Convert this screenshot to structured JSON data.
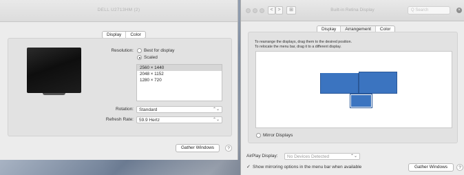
{
  "left_window": {
    "title": "DELL U2713HM (2)",
    "tabs": [
      "Display",
      "Color"
    ],
    "resolution_label": "Resolution:",
    "resolution_options": [
      "Best for display",
      "Scaled"
    ],
    "resolutions": [
      "2560 × 1440",
      "2048 × 1152",
      "1280 × 720"
    ],
    "rotation_label": "Rotation:",
    "rotation_value": "Standard",
    "refresh_label": "Refresh Rate:",
    "refresh_value": "59.9 Hertz",
    "gather_button": "Gather Windows",
    "help": "?"
  },
  "right_window": {
    "title": "Built-in Retina Display",
    "search_placeholder": "Q Search",
    "nav_back": "<",
    "nav_forward": ">",
    "grid_icon": "⊞",
    "tabs": [
      "Display",
      "Arrangement",
      "Color"
    ],
    "instruction_line1": "To rearrange the displays, drag them to the desired position.",
    "instruction_line2": "To relocate the menu bar, drag it to a different display.",
    "mirror_label": "Mirror Displays",
    "airplay_label": "AirPlay Display:",
    "airplay_value": "No Devices Detected",
    "mirroring_checkbox": "✓",
    "mirroring_option": "Show mirroring options in the menu bar when available",
    "gather_button": "Gather Windows",
    "help": "?"
  },
  "icons": {
    "up_down_arrows": "⌃⌄",
    "clear": "×"
  }
}
